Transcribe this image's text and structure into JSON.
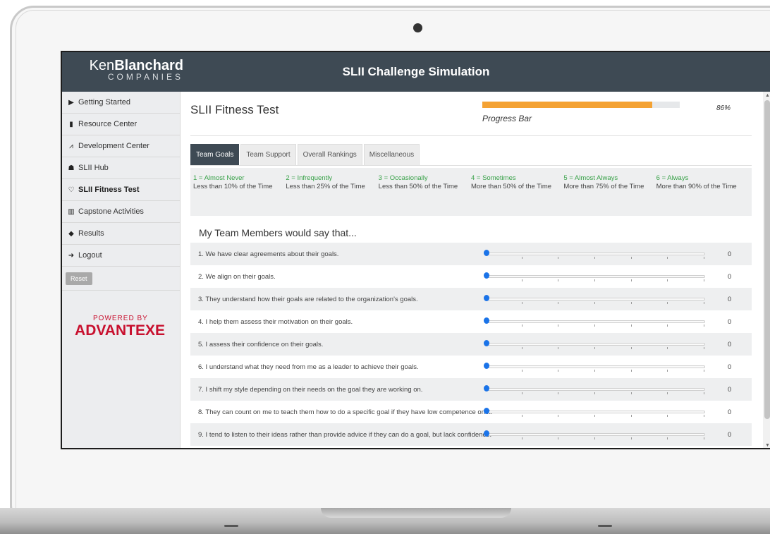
{
  "app": {
    "title": "SLII Challenge Simulation",
    "logo_ken": "Ken",
    "logo_blanchard": "Blanchard",
    "logo_sub": "COMPANIES"
  },
  "sidebar": {
    "items": [
      {
        "label": "Getting Started",
        "icon": "play-icon"
      },
      {
        "label": "Resource Center",
        "icon": "book-icon"
      },
      {
        "label": "Development Center",
        "icon": "chart-icon"
      },
      {
        "label": "SLII Hub",
        "icon": "users-icon"
      },
      {
        "label": "SLII Fitness Test",
        "icon": "heartbeat-icon",
        "active": true
      },
      {
        "label": "Capstone Activities",
        "icon": "bar-chart-icon"
      },
      {
        "label": "Results",
        "icon": "graduation-cap-icon"
      },
      {
        "label": "Logout",
        "icon": "logout-icon"
      }
    ],
    "reset_label": "Reset",
    "powered_by": "POWERED BY",
    "brand": "ADVANTEXE"
  },
  "main": {
    "page_title": "SLII Fitness Test",
    "progress": {
      "label": "Progress Bar",
      "percent_text": "86%",
      "value": 0.86
    },
    "tabs": [
      {
        "label": "Team Goals",
        "active": true
      },
      {
        "label": "Team Support"
      },
      {
        "label": "Overall Rankings"
      },
      {
        "label": "Miscellaneous"
      }
    ],
    "scale": [
      {
        "top": "1 = Almost Never",
        "bottom": "Less than 10% of the Time"
      },
      {
        "top": "2 = Infrequently",
        "bottom": "Less than 25% of the Time"
      },
      {
        "top": "3 = Occasionally",
        "bottom": "Less than 50% of the Time"
      },
      {
        "top": "4 = Sometimes",
        "bottom": "More than 50% of the Time"
      },
      {
        "top": "5 = Almost Always",
        "bottom": "More than 75% of the Time"
      },
      {
        "top": "6 = Always",
        "bottom": "More than 90% of the Time"
      }
    ],
    "section_title": "My Team Members would say that...",
    "questions": [
      {
        "text": "1. We have clear agreements about their goals.",
        "value": "0"
      },
      {
        "text": "2. We align on their goals.",
        "value": "0"
      },
      {
        "text": "3. They understand how their goals are related to the organization's goals.",
        "value": "0"
      },
      {
        "text": "4. I help them assess their motivation on their goals.",
        "value": "0"
      },
      {
        "text": "5. I assess their confidence on their goals.",
        "value": "0"
      },
      {
        "text": "6. I understand what they need from me as a leader to achieve their goals.",
        "value": "0"
      },
      {
        "text": "7. I shift my style depending on their needs on the goal they are working on.",
        "value": "0"
      },
      {
        "text": "8. They can count on me to teach them how to do a specific goal if they have low competence on it.",
        "value": "0"
      },
      {
        "text": "9. I tend to listen to their ideas rather than provide advice if they can do a goal, but lack confidence.",
        "value": "0"
      }
    ]
  },
  "colors": {
    "header": "#3e4a54",
    "progress": "#f4a233",
    "slider": "#1a73e8",
    "scale_green": "#3aa24a",
    "brand_red": "#c8102e"
  }
}
